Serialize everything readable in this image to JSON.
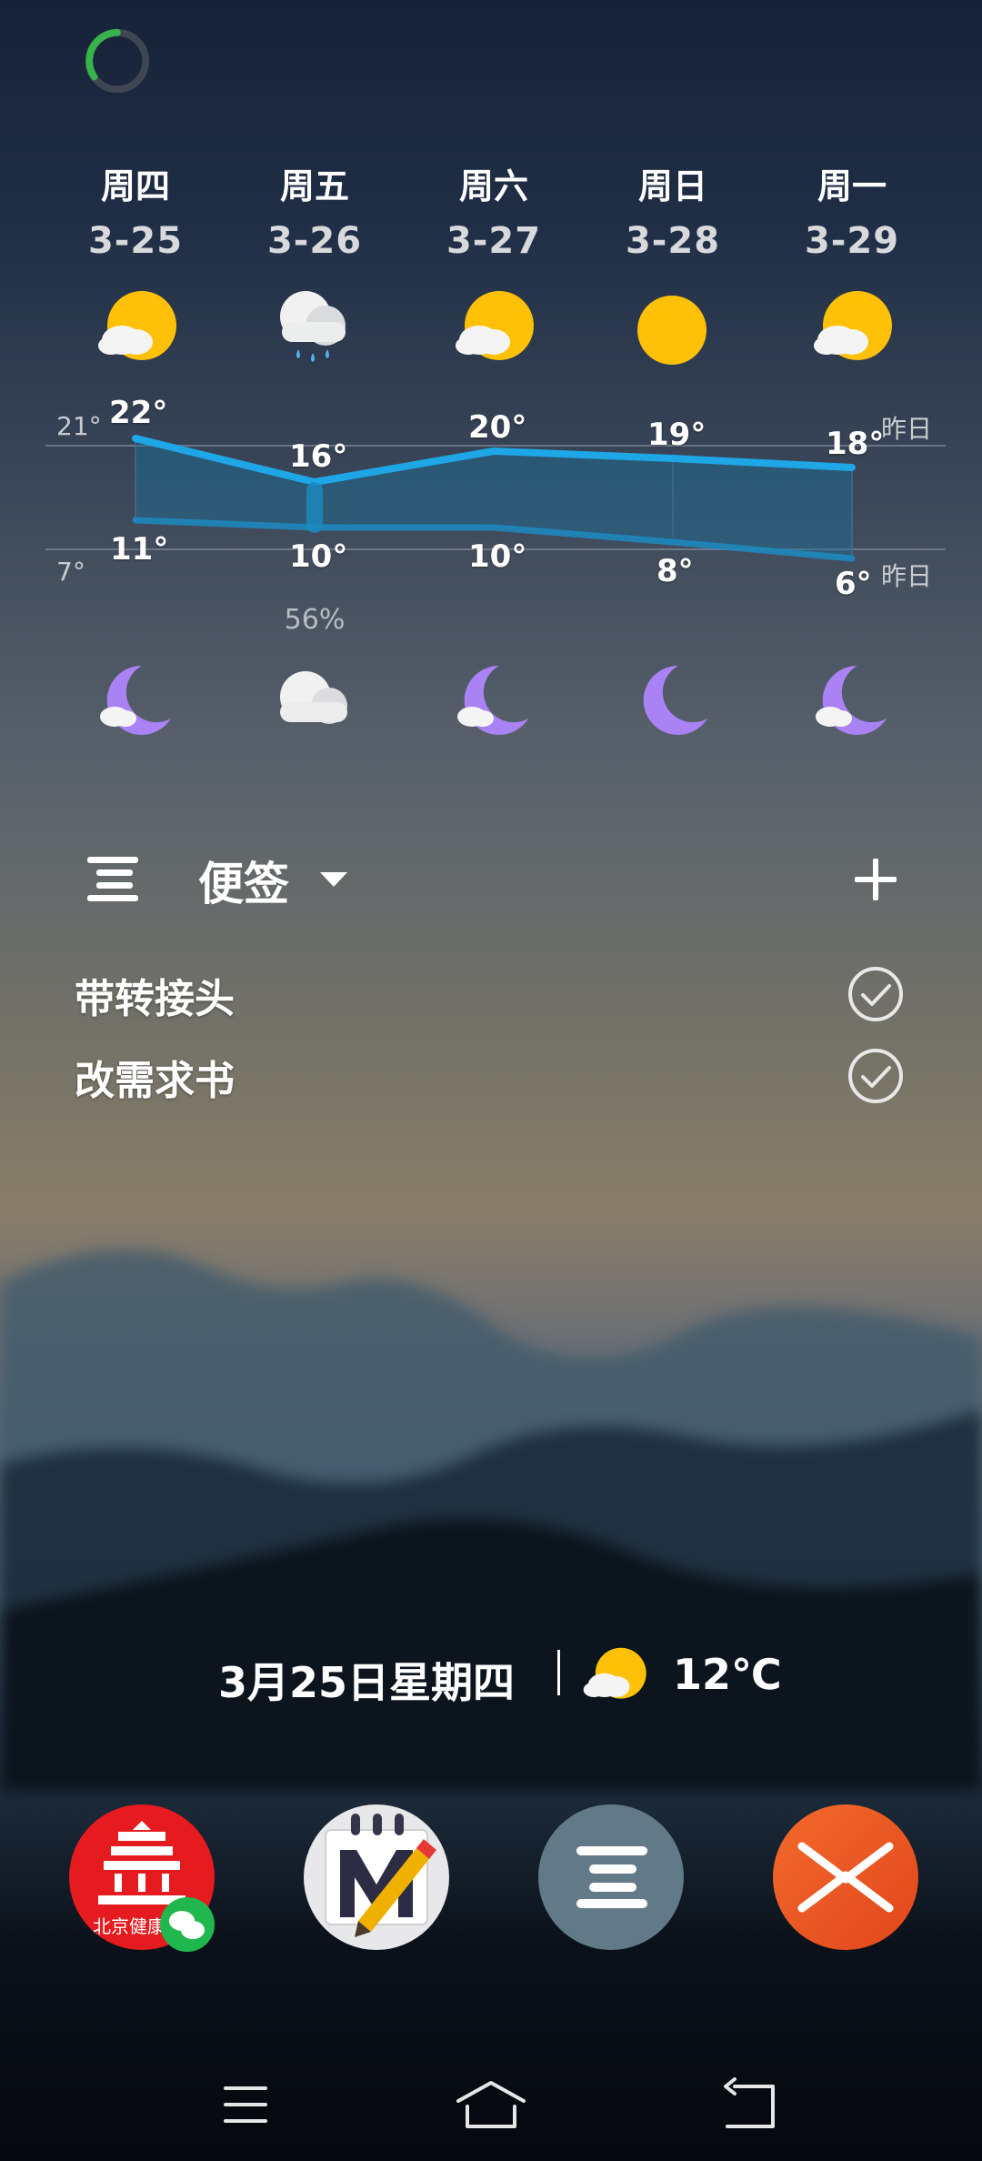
{
  "forecast": {
    "days": [
      {
        "day": "周四",
        "date": "3-25",
        "day_icon": "partly-cloudy-day-icon",
        "high": "22°",
        "low": "11°",
        "night_icon": "partly-cloudy-night-icon"
      },
      {
        "day": "周五",
        "date": "3-26",
        "day_icon": "rain-icon",
        "high": "16°",
        "low": "10°",
        "night_icon": "cloudy-icon",
        "precip": "56%"
      },
      {
        "day": "周六",
        "date": "3-27",
        "day_icon": "partly-cloudy-day-icon",
        "high": "20°",
        "low": "10°",
        "night_icon": "partly-cloudy-night-icon"
      },
      {
        "day": "周日",
        "date": "3-28",
        "day_icon": "sunny-icon",
        "high": "19°",
        "low": "8°",
        "night_icon": "clear-night-icon"
      },
      {
        "day": "周一",
        "date": "3-29",
        "day_icon": "partly-cloudy-day-icon",
        "high": "18°",
        "low": "6°",
        "night_icon": "partly-cloudy-night-icon"
      }
    ],
    "yesterday_high": "21°",
    "yesterday_low": "7°",
    "yesterday_label": "昨日",
    "colors": {
      "line": "#1ea6e6",
      "sun": "#ffc107",
      "moon": "#a982f4"
    }
  },
  "notes": {
    "title": "便签",
    "items": [
      {
        "text": "带转接头"
      },
      {
        "text": "改需求书"
      }
    ]
  },
  "status": {
    "date": "3月25日星期四",
    "weather_icon": "partly-cloudy-day-icon",
    "temperature": "12℃"
  },
  "dock": {
    "apps": [
      {
        "name": "北京健康宝",
        "icon": "beijing-health-icon",
        "color": "#e51b1f"
      },
      {
        "name": "",
        "icon": "markdown-editor-icon",
        "color": "#e8e8ea"
      },
      {
        "name": "",
        "icon": "notes-app-icon",
        "color": "#627a88"
      },
      {
        "name": "",
        "icon": "x-app-icon",
        "color": "#f05a22"
      }
    ],
    "label_partial": "北京健康"
  }
}
